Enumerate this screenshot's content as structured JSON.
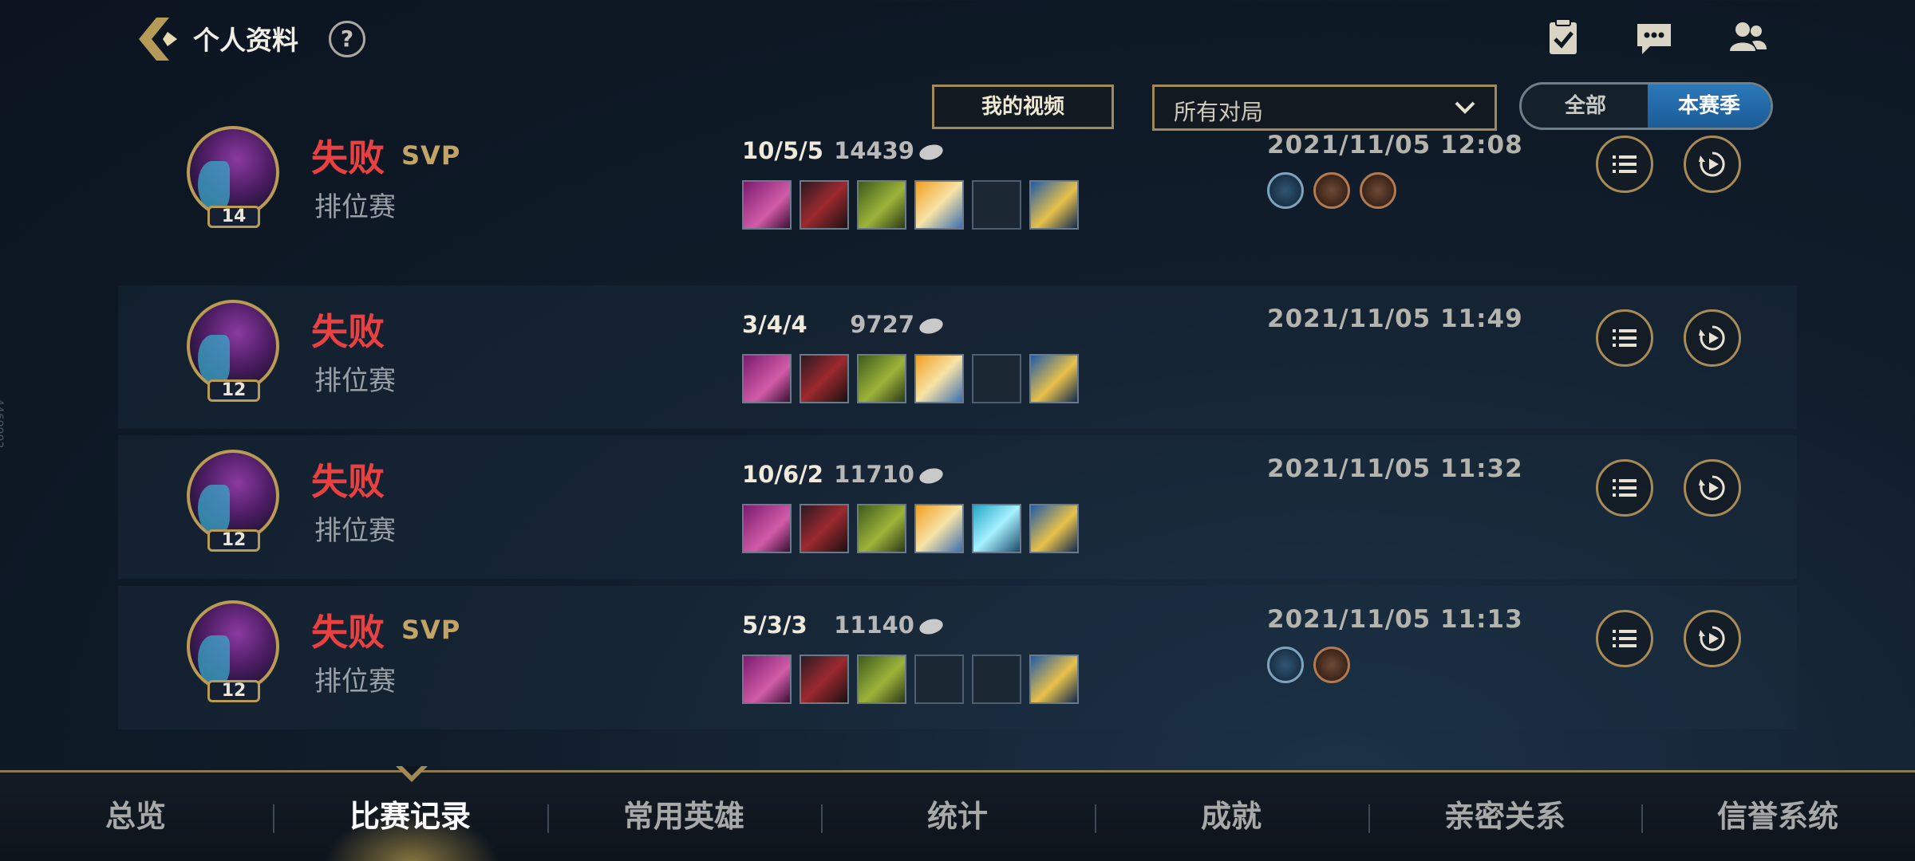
{
  "header": {
    "title": "个人资料",
    "help": "?",
    "icons": [
      "clipboard-check-icon",
      "chat-icon",
      "friends-icon"
    ]
  },
  "filters": {
    "video_button": "我的视频",
    "mode_select": "所有对局",
    "toggle": {
      "all": "全部",
      "season": "本赛季",
      "active": "本赛季"
    }
  },
  "matches": [
    {
      "level": "14",
      "result": "失败",
      "svp": "SVP",
      "mode": "排位赛",
      "kda": "10/5/5",
      "gold": "14439",
      "date": "2021/11/05 12:08",
      "items_filled": [
        1,
        1,
        1,
        1,
        0,
        1
      ],
      "badges": [
        "b1",
        "b2",
        "b3"
      ]
    },
    {
      "level": "12",
      "result": "失败",
      "svp": "",
      "mode": "排位赛",
      "kda": "3/4/4",
      "gold": "9727",
      "date": "2021/11/05 11:49",
      "items_filled": [
        1,
        1,
        1,
        1,
        0,
        1
      ],
      "badges": []
    },
    {
      "level": "12",
      "result": "失败",
      "svp": "",
      "mode": "排位赛",
      "kda": "10/6/2",
      "gold": "11710",
      "date": "2021/11/05 11:32",
      "items_filled": [
        1,
        1,
        1,
        1,
        1,
        1
      ],
      "badges": []
    },
    {
      "level": "12",
      "result": "失败",
      "svp": "SVP",
      "mode": "排位赛",
      "kda": "5/3/3",
      "gold": "11140",
      "date": "2021/11/05 11:13",
      "items_filled": [
        1,
        1,
        1,
        0,
        0,
        1
      ],
      "badges": [
        "b1",
        "b2"
      ]
    }
  ],
  "bottom_nav": {
    "items": [
      "总览",
      "比赛记录",
      "常用英雄",
      "统计",
      "成就",
      "亲密关系",
      "信誉系统"
    ],
    "active": "比赛记录"
  },
  "side_text": "4469902",
  "colors": {
    "accent_gold": "#b99b54",
    "defeat_red": "#e94141",
    "toggle_blue": "#2b78b9"
  }
}
